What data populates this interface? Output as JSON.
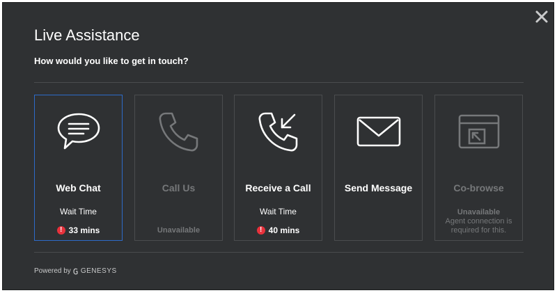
{
  "dialog": {
    "title": "Live Assistance",
    "subtitle": "How would you like to get in touch?"
  },
  "cards": [
    {
      "label": "Web Chat",
      "wait_label": "Wait Time",
      "wait_time": "33 mins",
      "icon": "chat-bubble-icon",
      "state": "selected"
    },
    {
      "label": "Call Us",
      "status": "Unavailable",
      "icon": "phone-icon",
      "state": "disabled"
    },
    {
      "label": "Receive a Call",
      "wait_label": "Wait Time",
      "wait_time": "40 mins",
      "icon": "phone-incoming-icon",
      "state": "enabled"
    },
    {
      "label": "Send Message",
      "icon": "envelope-icon",
      "state": "enabled"
    },
    {
      "label": "Co-browse",
      "status": "Unavailable",
      "status_line1": "Agent connection is",
      "status_line2": "required for this.",
      "icon": "cobrowse-icon",
      "state": "disabled"
    }
  ],
  "footer": {
    "powered_by": "Powered by",
    "brand": "GENESYS"
  },
  "colors": {
    "background": "#2f3133",
    "border": "#4a4c4e",
    "selected_border": "#2d6bc9",
    "alert": "#e8323c",
    "disabled_text": "#76787a"
  }
}
